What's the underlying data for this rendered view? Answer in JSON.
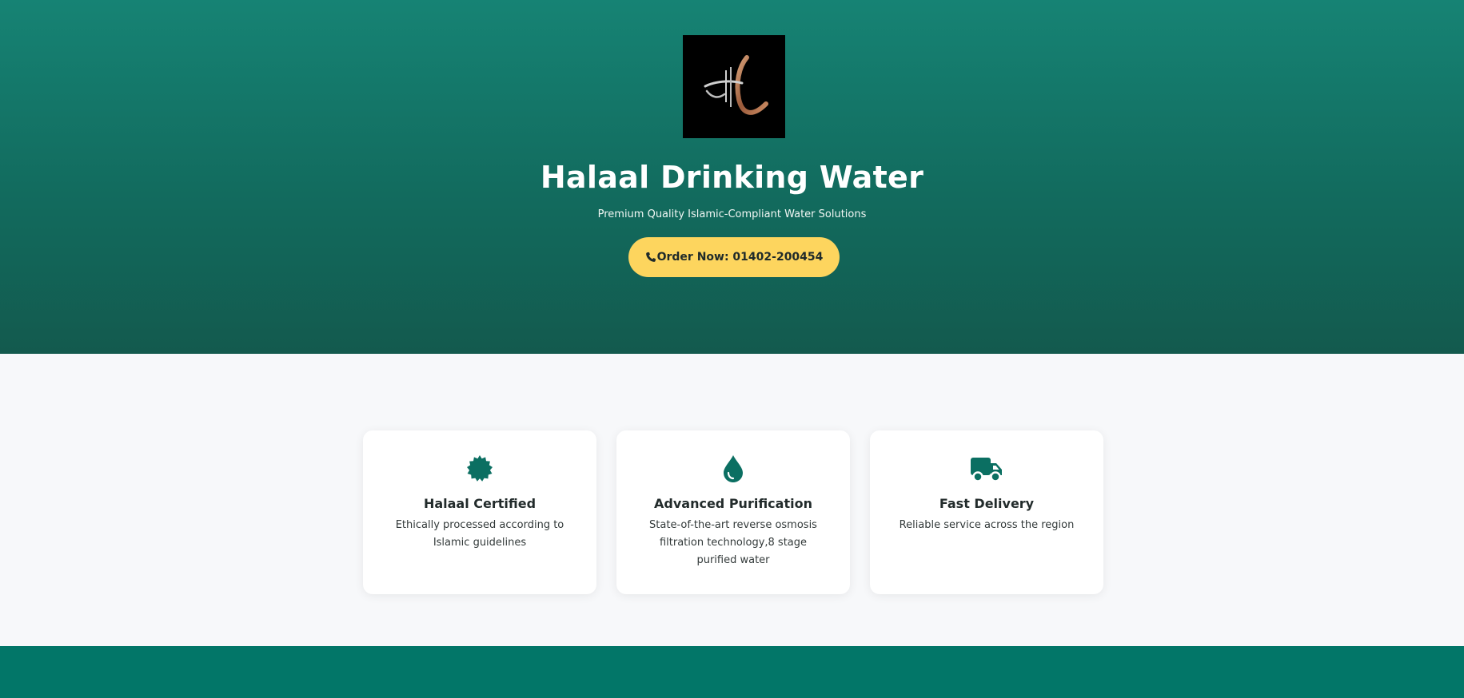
{
  "hero": {
    "title": "Halaal Drinking Water",
    "subtitle": "Premium Quality Islamic-Compliant Water Solutions",
    "order_button_label": "Order Now: 01402-200454",
    "order_button_icon": "phone-icon",
    "logo_icon": "halaal-logo"
  },
  "features": [
    {
      "icon": "badge-check-icon",
      "title": "Halaal Certified",
      "text": "Ethically processed according to Islamic guidelines"
    },
    {
      "icon": "water-drop-icon",
      "title": "Advanced Purification",
      "text": "State-of-the-art reverse osmosis filtration technology,8 stage purified water"
    },
    {
      "icon": "truck-icon",
      "title": "Fast Delivery",
      "text": "Reliable service across the region"
    }
  ],
  "colors": {
    "hero_top": "#168374",
    "hero_bottom": "#135a4e",
    "accent_button": "#fdd55e",
    "icon_teal": "#0b6f62",
    "footer_band": "#027668",
    "section_bg": "#f7f8fa"
  }
}
